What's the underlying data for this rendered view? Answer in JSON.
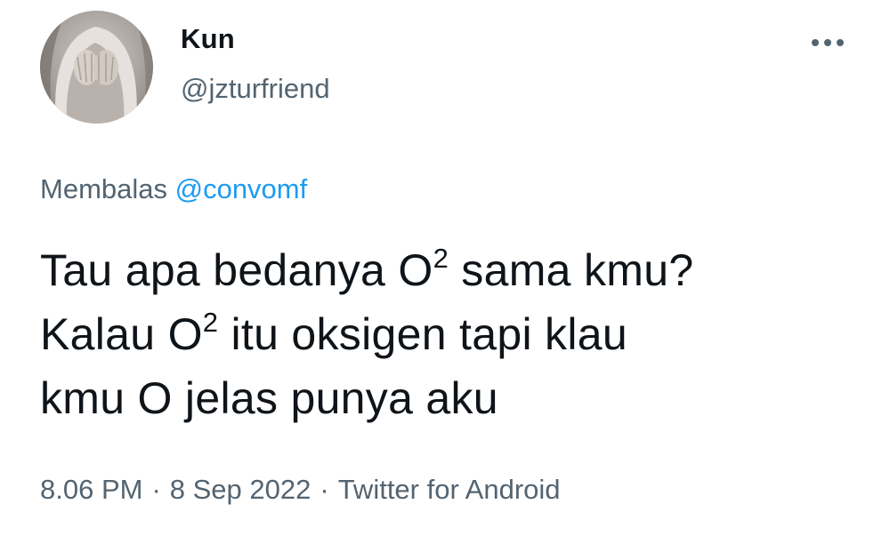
{
  "author": {
    "display_name": "Kun",
    "handle": "@jzturfriend",
    "avatar_icon": "hooded-figure-avatar"
  },
  "menu": {
    "icon": "more-horizontal-icon"
  },
  "reply": {
    "prefix": "Membalas ",
    "mention": "@convomf"
  },
  "tweet": {
    "lines": [
      {
        "before": "Tau apa bedanya O",
        "sup": "2",
        "after": " sama kmu?"
      },
      {
        "before": "Kalau O",
        "sup": "2",
        "after": " itu oksigen tapi klau"
      },
      {
        "before": "kmu O jelas punya aku",
        "sup": "",
        "after": ""
      }
    ]
  },
  "meta": {
    "time": "8.06 PM",
    "separator": "·",
    "date": "8 Sep 2022",
    "source": "Twitter for Android"
  },
  "colors": {
    "text": "#0f1419",
    "secondary": "#536471",
    "link": "#1d9bf0",
    "background": "#ffffff"
  }
}
